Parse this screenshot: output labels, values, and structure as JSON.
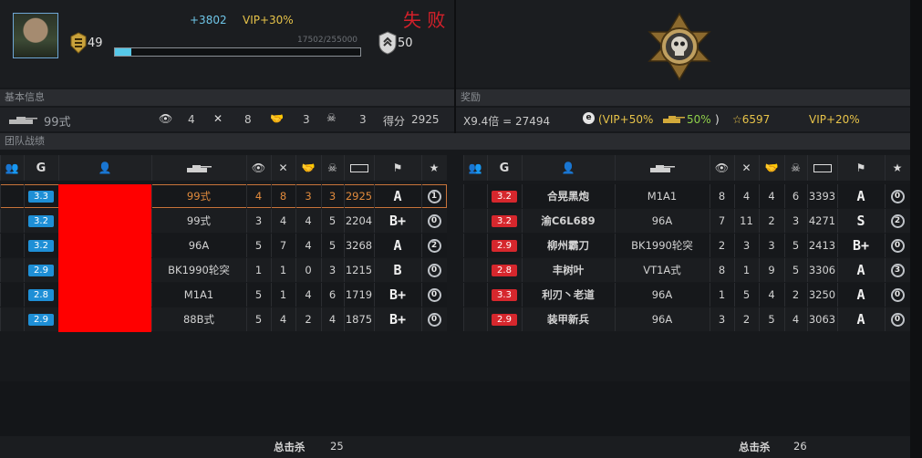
{
  "header": {
    "xp_gain": "+3802",
    "vip_bonus": "VIP+30%",
    "result": "失 败",
    "level": "49",
    "xp_progress_text": "17502/255000",
    "xp_progress_fraction": 0.0686,
    "rank_value": "50"
  },
  "sections": {
    "basic_info": "基本信息",
    "reward": "奖励",
    "team_record": "团队战绩"
  },
  "basic_info": {
    "tank_name": "99式",
    "spot": "4",
    "destroy": "8",
    "assist": "3",
    "kills": "3",
    "score_label": "得分",
    "score": "2925"
  },
  "reward": {
    "multiplier_text": "X9.4倍 = 27494",
    "vip_open": "(VIP+50%",
    "tank_bonus": "50%",
    "close_paren": ")",
    "stars": "☆6597",
    "vip_stars": "VIP+20%"
  },
  "teams": {
    "left": [
      {
        "level": "3.3",
        "name": "",
        "tank": "99式",
        "spot": "4",
        "destroy": "8",
        "assist": "3",
        "kills": "3",
        "damage": "2925",
        "grade": "A",
        "medal": "1",
        "me": true
      },
      {
        "level": "3.2",
        "name": "",
        "tank": "99式",
        "spot": "3",
        "destroy": "4",
        "assist": "4",
        "kills": "5",
        "damage": "2204",
        "grade": "B+",
        "medal": "0"
      },
      {
        "level": "3.2",
        "name": "",
        "tank": "96A",
        "spot": "5",
        "destroy": "7",
        "assist": "4",
        "kills": "5",
        "damage": "3268",
        "grade": "A",
        "medal": "2"
      },
      {
        "level": "2.9",
        "name": "",
        "tank": "BK1990轮突",
        "spot": "1",
        "destroy": "1",
        "assist": "0",
        "kills": "3",
        "damage": "1215",
        "grade": "B",
        "medal": "0"
      },
      {
        "level": "2.8",
        "name": "",
        "tank": "M1A1",
        "spot": "5",
        "destroy": "1",
        "assist": "4",
        "kills": "6",
        "damage": "1719",
        "grade": "B+",
        "medal": "0"
      },
      {
        "level": "2.9",
        "name": "",
        "tank": "88B式",
        "spot": "5",
        "destroy": "4",
        "assist": "2",
        "kills": "4",
        "damage": "1875",
        "grade": "B+",
        "medal": "0"
      }
    ],
    "right": [
      {
        "level": "3.2",
        "name": "合晃黑炮",
        "tank": "M1A1",
        "spot": "8",
        "destroy": "4",
        "assist": "4",
        "kills": "6",
        "damage": "3393",
        "grade": "A",
        "medal": "0"
      },
      {
        "level": "3.2",
        "name": "渝C6L689",
        "tank": "96A",
        "spot": "7",
        "destroy": "11",
        "assist": "2",
        "kills": "3",
        "damage": "4271",
        "grade": "S",
        "medal": "2"
      },
      {
        "level": "2.9",
        "name": "柳州霸刀",
        "tank": "BK1990轮突",
        "spot": "2",
        "destroy": "3",
        "assist": "3",
        "kills": "5",
        "damage": "2413",
        "grade": "B+",
        "medal": "0"
      },
      {
        "level": "2.8",
        "name": "丰树叶",
        "tank": "VT1A式",
        "spot": "8",
        "destroy": "1",
        "assist": "9",
        "kills": "5",
        "damage": "3306",
        "grade": "A",
        "medal": "3"
      },
      {
        "level": "3.3",
        "name": "利刃丶老道",
        "tank": "96A",
        "spot": "1",
        "destroy": "5",
        "assist": "4",
        "kills": "2",
        "damage": "3250",
        "grade": "A",
        "medal": "0"
      },
      {
        "level": "2.9",
        "name": "装甲新兵",
        "tank": "96A",
        "spot": "3",
        "destroy": "2",
        "assist": "5",
        "kills": "4",
        "damage": "3063",
        "grade": "A",
        "medal": "0"
      }
    ]
  },
  "footer": {
    "total_kills_label": "总击杀",
    "left_total": "25",
    "right_total": "26"
  },
  "colors": {
    "defeat": "#d4202a",
    "vip": "#e7c349",
    "xp": "#6fc6e8",
    "blue_level": "#1e8fd6",
    "red_level": "#d6272d",
    "highlight": "#e08a3c",
    "censor": "#ff0000"
  }
}
